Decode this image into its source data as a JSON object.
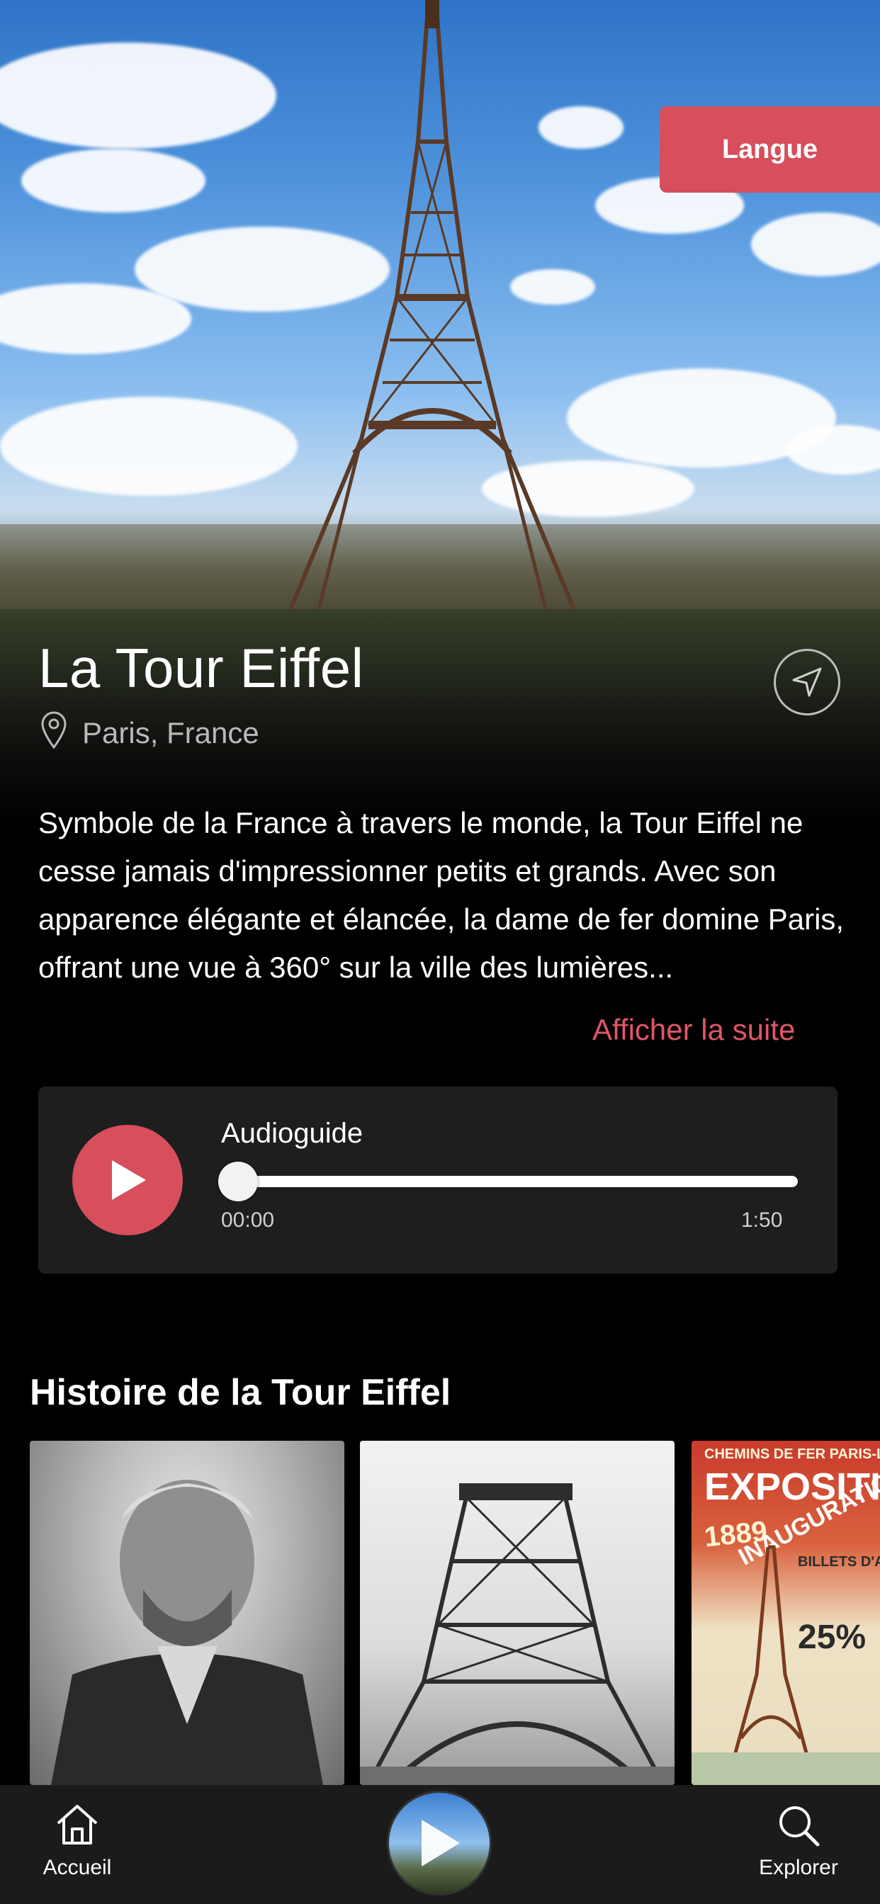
{
  "header": {
    "language_button": "Langue"
  },
  "place": {
    "title": "La Tour Eiffel",
    "location": "Paris, France",
    "description": "Symbole de la France à travers le monde, la Tour Eiffel ne cesse jamais d'impressionner petits et grands. Avec son apparence élégante et élancée, la dame de fer domine Paris, offrant une vue à 360° sur la ville des lumières...",
    "more_link": "Afficher la suite"
  },
  "audioguide": {
    "label": "Audioguide",
    "current_time": "00:00",
    "duration": "1:50",
    "progress": 0
  },
  "history": {
    "title": "Histoire de la Tour Eiffel",
    "poster": {
      "line1": "CHEMINS DE FER PARIS-LYON",
      "line2": "EXPOSITION UN",
      "line3": "1889",
      "line4": "INAUGURATION DE L",
      "line5": "25%",
      "line6": "BILLETS D'ALLER"
    }
  },
  "tabbar": {
    "home": "Accueil",
    "explore": "Explorer"
  },
  "colors": {
    "accent": "#d74e5d",
    "link": "#e05665",
    "card_bg": "#1e1e1e",
    "tabbar_bg": "#1b1b1b"
  }
}
